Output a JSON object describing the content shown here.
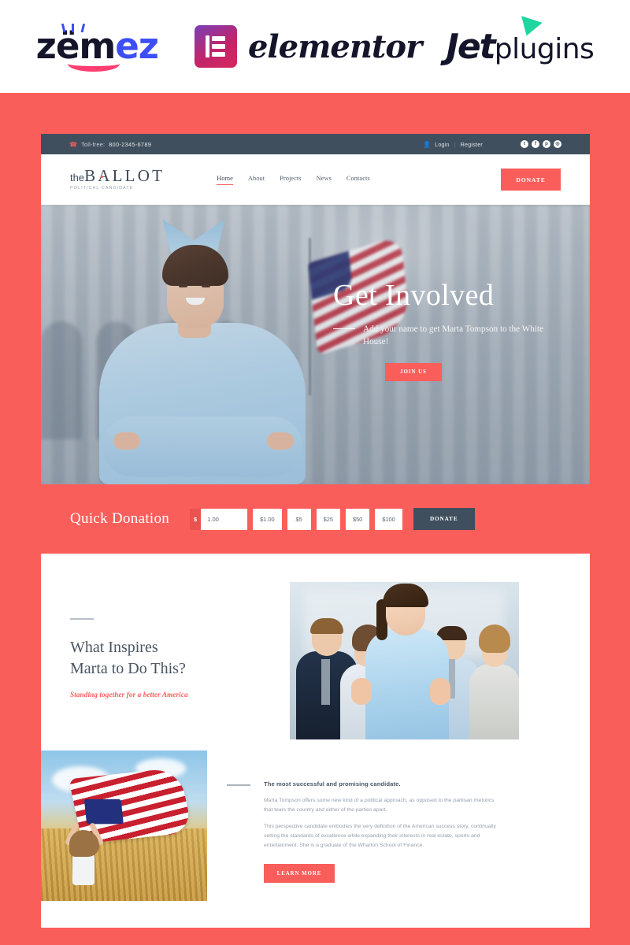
{
  "logo_strip": {
    "brands": [
      {
        "name": "Zemez",
        "text_dark": "z",
        "text_mid": "ëm",
        "text_blue": "e",
        "full": "zemez"
      },
      {
        "name": "Elementor",
        "label": "elementor"
      },
      {
        "name": "JetPlugins",
        "label_bold": "Jet",
        "label_light": "plugins"
      }
    ]
  },
  "topbar": {
    "phone_icon": "phone-icon",
    "phone_label": "Toll-free:",
    "phone_number": "800-2345-6789",
    "user_icon": "user-icon",
    "login": "Login",
    "separator": "|",
    "register": "Register",
    "social": [
      {
        "name": "twitter-icon",
        "glyph": "t"
      },
      {
        "name": "facebook-icon",
        "glyph": "f"
      },
      {
        "name": "pinterest-icon",
        "glyph": "p"
      },
      {
        "name": "rss-icon",
        "glyph": "◎"
      }
    ]
  },
  "header": {
    "logo_the": "the",
    "logo_ballot": "BALLOT",
    "logo_sub": "POLITICAL CANDIDATE",
    "nav": [
      {
        "label": "Home",
        "active": true
      },
      {
        "label": "About",
        "active": false
      },
      {
        "label": "Projects",
        "active": false
      },
      {
        "label": "News",
        "active": false
      },
      {
        "label": "Contacts",
        "active": false
      }
    ],
    "donate_label": "DONATE"
  },
  "hero": {
    "title": "Get Involved",
    "subtitle": "Add your name to get Marta Tompson to the White House!",
    "cta_label": "JOIN US"
  },
  "quick_donation": {
    "title": "Quick Donation",
    "currency_symbol": "$",
    "amount_value": "1.00",
    "amount_placeholder": "1.00",
    "presets": [
      "$1.00",
      "$5",
      "$25",
      "$50",
      "$100"
    ],
    "donate_label": "DONATE"
  },
  "inspire": {
    "heading_line1": "What Inspires",
    "heading_line2": "Marta to Do This?",
    "tagline": "Standing together for a better America",
    "lead": "The most successful and promising candidate.",
    "paragraph1": "Marta Tompson offers some new kind of a political approach, as opposed to the partisan rhetorics that tears the country and either of the parties apart.",
    "paragraph2": "This perspective candidate embodies the very definition of the American success story, continually setting the standards of excellence while expanding their interests in real estate, sports and entertainment. She is a graduate of the Wharton School of Finance.",
    "learn_more_label": "LEARN MORE"
  },
  "colors": {
    "coral": "#fa5e5b",
    "navy": "#404f5e",
    "heading": "#4a5562",
    "body_text": "#96a0ab"
  }
}
